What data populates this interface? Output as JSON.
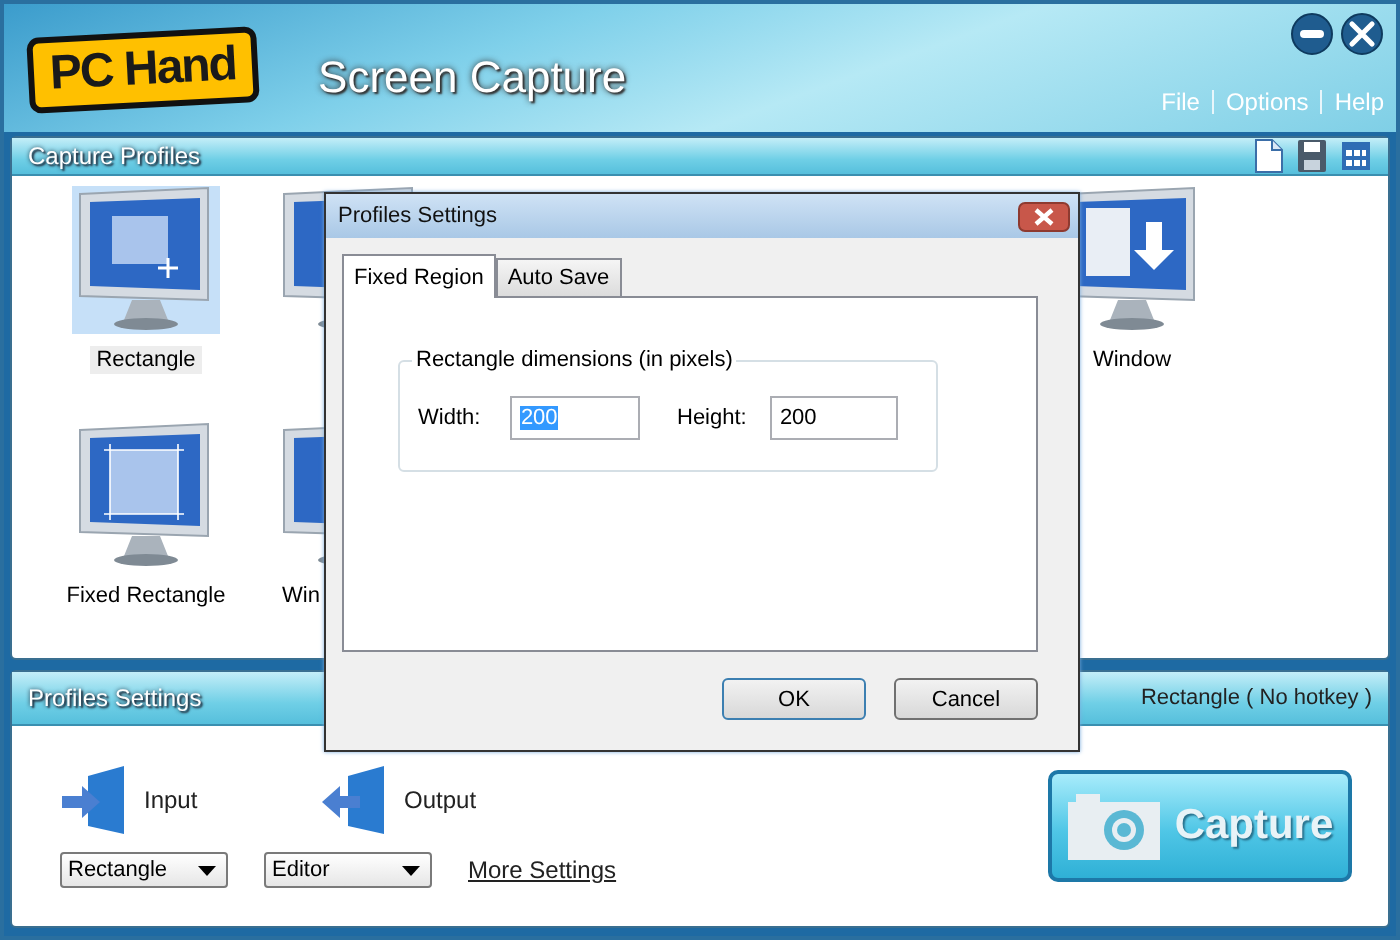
{
  "window": {
    "app_name": "PC Hand",
    "title": "Screen Capture"
  },
  "menu": [
    "File",
    "Options",
    "Help"
  ],
  "capture_profiles": {
    "title": "Capture Profiles",
    "profiles": [
      {
        "label": "Rectangle",
        "kind": "rectangle",
        "selected": true
      },
      {
        "kind": "plain",
        "selected": false
      },
      {
        "label": "Window",
        "kind": "window",
        "selected": false
      },
      {
        "label": "Fixed Rectangle",
        "kind": "fixed",
        "selected": false
      },
      {
        "label": "Win",
        "kind": "plain",
        "selected": false
      }
    ]
  },
  "profiles_settings": {
    "title": "Profiles Settings",
    "current": "Rectangle ( No hotkey )",
    "input": {
      "label": "Input",
      "value": "Rectangle"
    },
    "output": {
      "label": "Output",
      "value": "Editor"
    },
    "link": "More Settings",
    "capture_button": "Capture"
  },
  "dialog": {
    "title": "Profiles Settings",
    "tabs": [
      {
        "label": "Fixed Region",
        "selected": true
      },
      {
        "label": "Auto Save",
        "selected": false
      }
    ],
    "group": "Rectangle dimensions (in pixels)",
    "fields": [
      {
        "label": "Width:",
        "value": "200",
        "selected": true
      },
      {
        "label": "Height:",
        "value": "200",
        "selected": false
      }
    ],
    "buttons": [
      "OK",
      "Cancel"
    ]
  }
}
